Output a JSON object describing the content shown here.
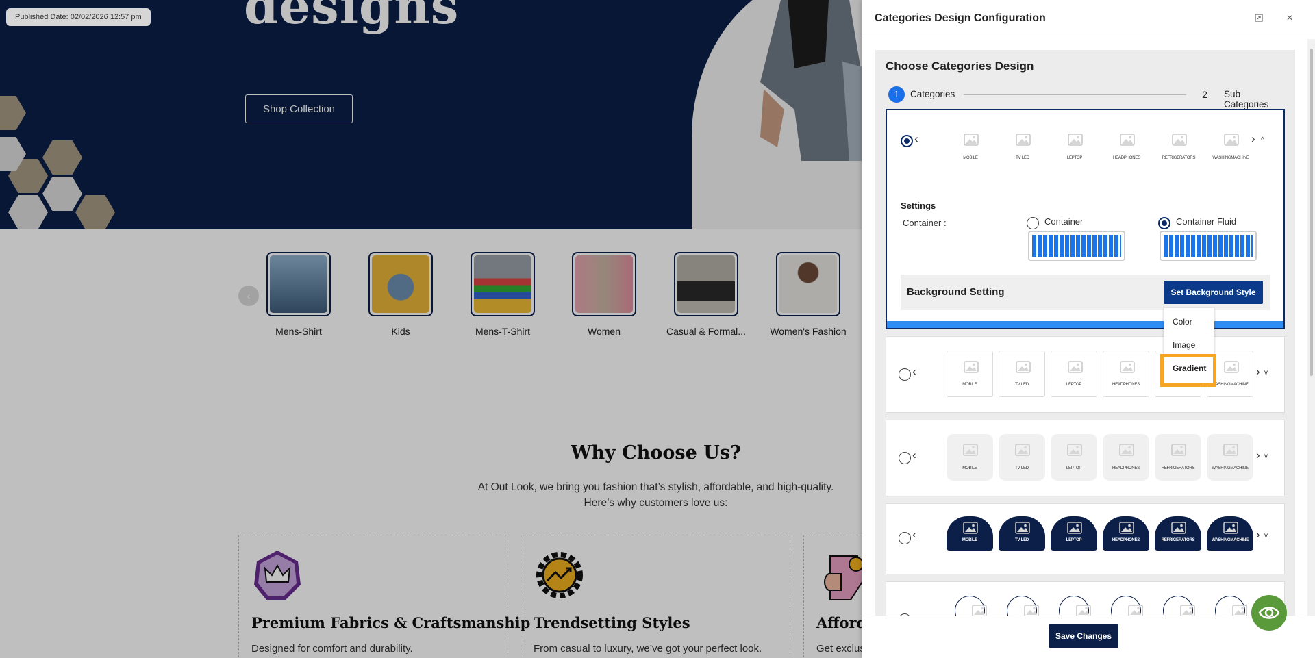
{
  "published": "Published Date: 02/02/2026 12:57 pm",
  "hero": {
    "title": "designs",
    "cta": "Shop Collection"
  },
  "categories": [
    {
      "label": "Mens-Shirt"
    },
    {
      "label": "Kids"
    },
    {
      "label": "Mens-T-Shirt"
    },
    {
      "label": "Women"
    },
    {
      "label": "Casual & Formal..."
    },
    {
      "label": "Women's Fashion"
    }
  ],
  "why": {
    "title": "Why Choose Us?",
    "line1": "At Out Look, we bring you fashion that’s stylish, affordable, and high-quality.",
    "line2": "Here’s why customers love us:"
  },
  "features": [
    {
      "title": "Premium Fabrics & Craftsmanship",
      "desc": "Designed for comfort and durability."
    },
    {
      "title": "Trendsetting Styles",
      "desc": "From casual to luxury, we’ve got your perfect look."
    },
    {
      "title": "Afford",
      "desc": "Get exclus"
    }
  ],
  "panel": {
    "title": "Categories Design Configuration",
    "choose_title": "Choose Categories Design",
    "steps": [
      {
        "num": "1",
        "label": "Categories"
      },
      {
        "num": "2",
        "label": "Sub Categories"
      }
    ],
    "thumb_labels": [
      "MOBILE",
      "TV LED",
      "LEPTOP",
      "HEADPHONES",
      "REFRIGERATORS",
      "WASHINGMACHINE"
    ],
    "settings": {
      "title": "Settings",
      "container_label": "Container :",
      "option_container": "Container",
      "option_fluid": "Container Fluid",
      "bg_title": "Background Setting",
      "bg_button": "Set Background Style"
    },
    "dropdown": [
      "Color",
      "Image",
      "Gradient"
    ],
    "save": "Save Changes"
  },
  "colors": {
    "navy": "#0b1f48",
    "accent_blue": "#1b6fe8",
    "highlight": "#f6a623",
    "fab_green": "#5b9a3a"
  }
}
